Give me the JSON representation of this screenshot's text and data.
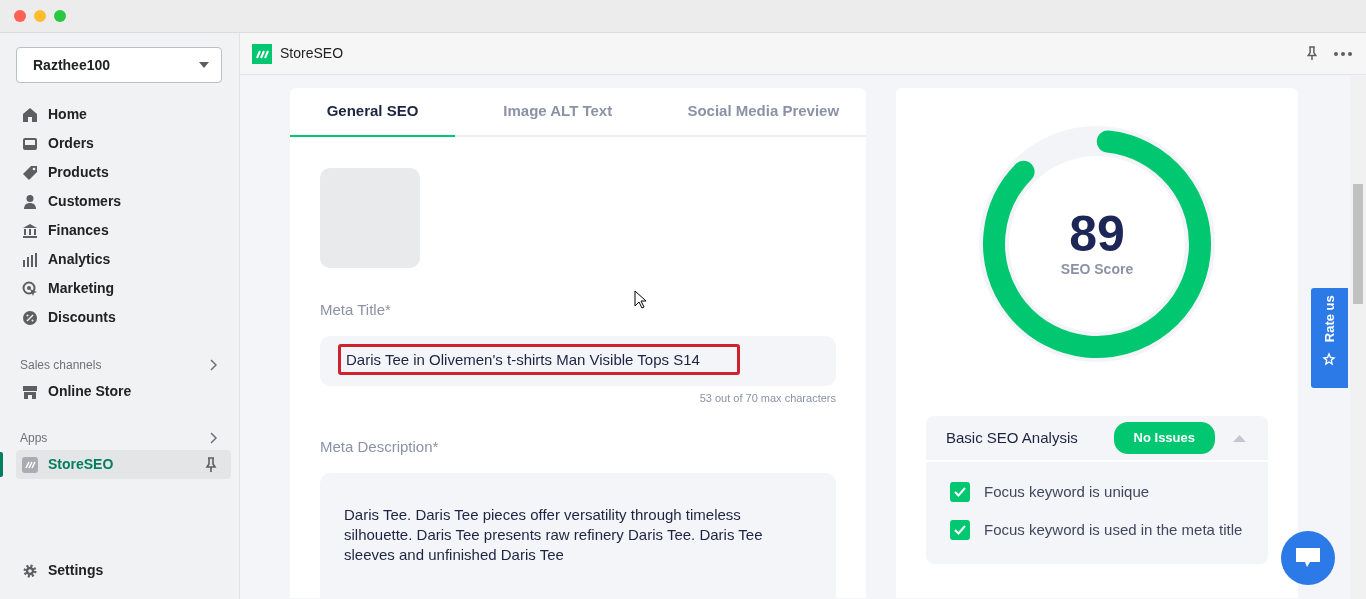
{
  "store_selector": {
    "value": "Razthee100"
  },
  "sidebar": {
    "items": [
      {
        "label": "Home",
        "selected": false
      },
      {
        "label": "Orders",
        "selected": false
      },
      {
        "label": "Products",
        "selected": false
      },
      {
        "label": "Customers",
        "selected": false
      },
      {
        "label": "Finances",
        "selected": false
      },
      {
        "label": "Analytics",
        "selected": false
      },
      {
        "label": "Marketing",
        "selected": false
      },
      {
        "label": "Discounts",
        "selected": false
      }
    ],
    "sections": [
      {
        "title": "Sales channels",
        "items": [
          {
            "label": "Online Store",
            "selected": false,
            "pinned": false
          }
        ]
      },
      {
        "title": "Apps",
        "items": [
          {
            "label": "StoreSEO",
            "selected": true,
            "pinned": true
          }
        ]
      }
    ],
    "settings": {
      "label": "Settings"
    }
  },
  "app_header": {
    "title": "StoreSEO"
  },
  "tabs": [
    {
      "label": "General SEO",
      "selected": true
    },
    {
      "label": "Image ALT Text",
      "selected": false
    },
    {
      "label": "Social Media Preview",
      "selected": false
    }
  ],
  "meta_title": {
    "label": "Meta Title*",
    "value": "Daris Tee in Olivemen's t-shirts Man Visible Tops S14",
    "highlighted": true,
    "counter": "53 out of 70 max characters"
  },
  "meta_description": {
    "label": "Meta Description*",
    "value": "Daris Tee. Daris Tee pieces offer versatility through timeless silhouette. Daris Tee presents raw refinery Daris Tee. Daris Tee sleeves and unfinished Daris Tee"
  },
  "seo_score": {
    "value": "89",
    "label": "SEO Score",
    "level": 0.89
  },
  "analysis": {
    "title": "Basic SEO Analysis",
    "badge": "No Issues",
    "expanded": true,
    "items": [
      {
        "text": "Focus keyword is unique",
        "checked": true
      },
      {
        "text": "Focus keyword is used in the meta title",
        "checked": true
      }
    ]
  },
  "rate_us": {
    "label": "Rate us"
  }
}
